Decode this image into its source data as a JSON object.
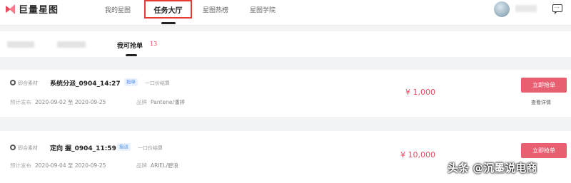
{
  "app": {
    "logo_text": "巨量星图",
    "brand_colors": {
      "primary": "#e8495f",
      "secondary": "#f07f8e"
    }
  },
  "nav": {
    "items": [
      {
        "label": "我的星图"
      },
      {
        "label": "任务大厅",
        "active": true
      },
      {
        "label": "星图热榜"
      },
      {
        "label": "星图学院"
      }
    ]
  },
  "filter": {
    "tab_label": "我可抢单",
    "tab_count": "13"
  },
  "tasks": [
    {
      "source_label": "即合素材",
      "title": "系统分派_0904_14:27",
      "tag": "抢单",
      "pay_type": "一口价结算",
      "date_label": "预计发布",
      "date_range": "2020-09-02 至 2020-09-25",
      "brand_label": "品牌",
      "brand": "Pantene/潘婷",
      "price": "¥ 1,000",
      "action_label": "立即抢单",
      "detail_label": "查看详情"
    },
    {
      "source_label": "即合素材",
      "title": "定向 握_0904_11:59",
      "tag": "指派",
      "pay_type": "一口价结算",
      "date_label": "预计发布",
      "date_range": "2020-09-04 至 2020-09-25",
      "brand_label": "品牌",
      "brand": "ARIEL/碧浪",
      "price": "¥ 10,000",
      "action_label": "立即抢单"
    }
  ],
  "watermark": "头条 @沉墨说电商"
}
